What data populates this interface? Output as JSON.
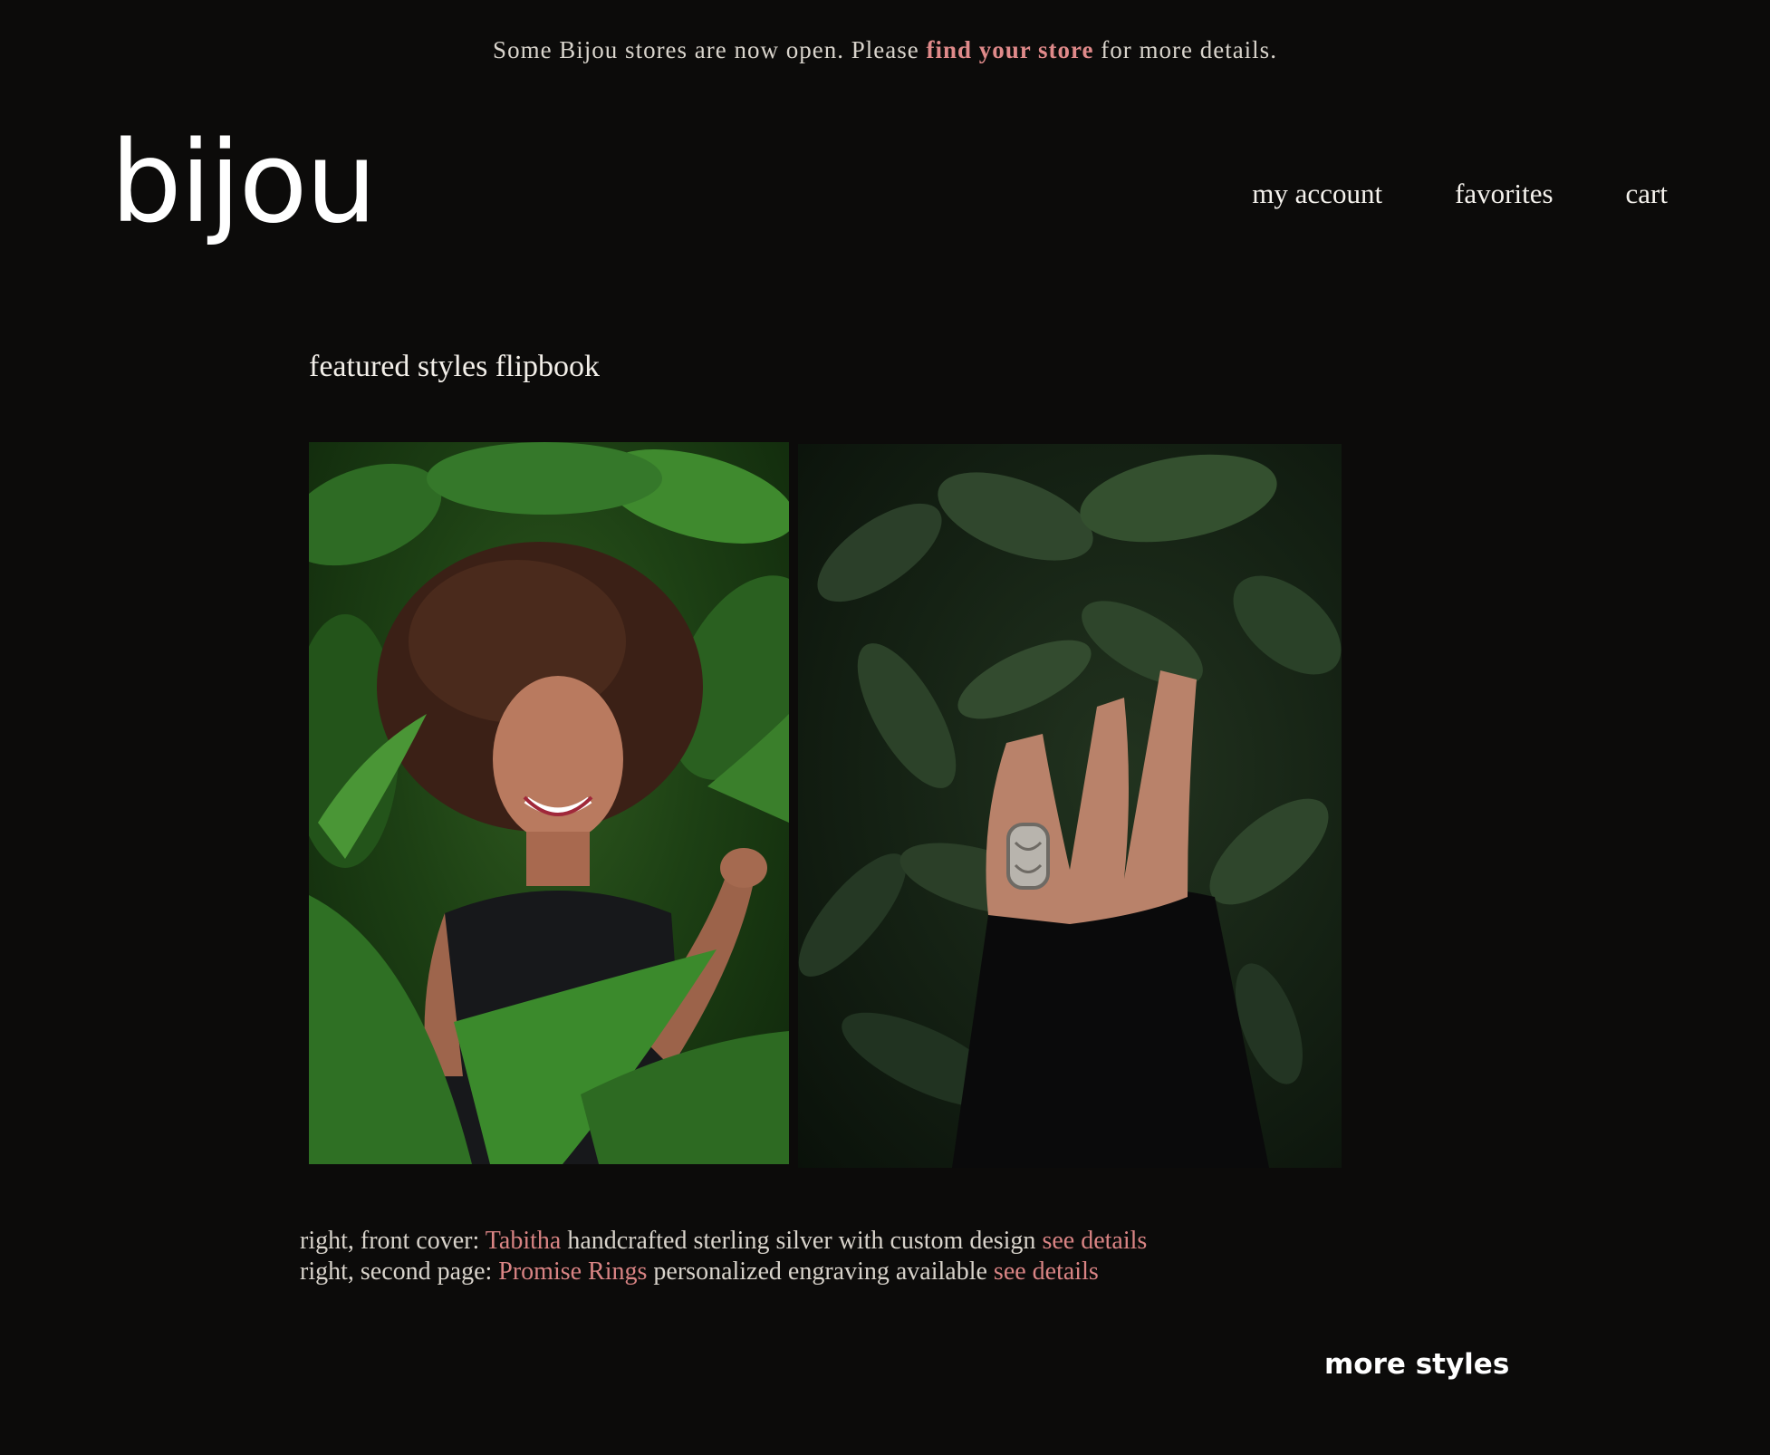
{
  "banner": {
    "prefix": "Some Bijou stores are now open. Please ",
    "link": "find your store",
    "suffix": " for more details."
  },
  "logo": "bijou",
  "nav": {
    "account": "my account",
    "favorites": "favorites",
    "cart": "cart"
  },
  "section_title": "featured styles flipbook",
  "captions": [
    {
      "prefix": "right, front cover: ",
      "product": "Tabitha",
      "description": " handcrafted sterling silver with custom design ",
      "details": "see details"
    },
    {
      "prefix": "right, second page: ",
      "product": "Promise Rings",
      "description": " personalized engraving available ",
      "details": "see details"
    }
  ],
  "more_styles": "more styles",
  "colors": {
    "background": "#0c0b0a",
    "accent": "#d98484",
    "text": "#f2efe9"
  }
}
